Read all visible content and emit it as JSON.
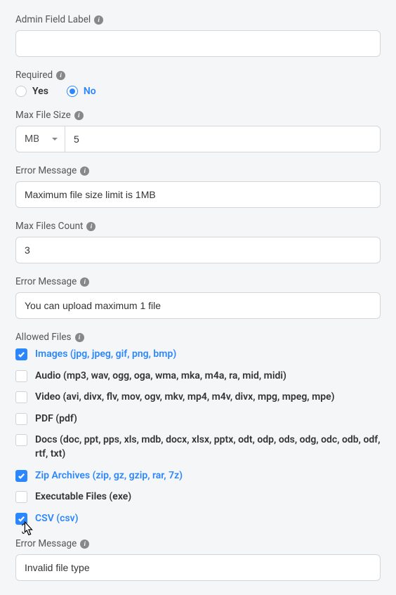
{
  "adminFieldLabel": {
    "label": "Admin Field Label",
    "value": ""
  },
  "required": {
    "label": "Required",
    "yes": "Yes",
    "no": "No",
    "selected": "no"
  },
  "maxFileSize": {
    "label": "Max File Size",
    "unit": "MB",
    "value": "5"
  },
  "errorMessage1": {
    "label": "Error Message",
    "value": "Maximum file size limit is 1MB"
  },
  "maxFilesCount": {
    "label": "Max Files Count",
    "value": "3"
  },
  "errorMessage2": {
    "label": "Error Message",
    "value": "You can upload maximum 1 file"
  },
  "allowedFiles": {
    "label": "Allowed Files",
    "options": [
      {
        "label": "Images (jpg, jpeg, gif, png, bmp)",
        "checked": true
      },
      {
        "label": "Audio (mp3, wav, ogg, oga, wma, mka, m4a, ra, mid, midi)",
        "checked": false
      },
      {
        "label": "Video (avi, divx, flv, mov, ogv, mkv, mp4, m4v, divx, mpg, mpeg, mpe)",
        "checked": false
      },
      {
        "label": "PDF (pdf)",
        "checked": false
      },
      {
        "label": "Docs (doc, ppt, pps, xls, mdb, docx, xlsx, pptx, odt, odp, ods, odg, odc, odb, odf, rtf, txt)",
        "checked": false
      },
      {
        "label": "Zip Archives (zip, gz, gzip, rar, 7z)",
        "checked": true
      },
      {
        "label": "Executable Files (exe)",
        "checked": false
      },
      {
        "label": "CSV (csv)",
        "checked": true
      }
    ]
  },
  "errorMessage3": {
    "label": "Error Message",
    "value": "Invalid file type"
  }
}
